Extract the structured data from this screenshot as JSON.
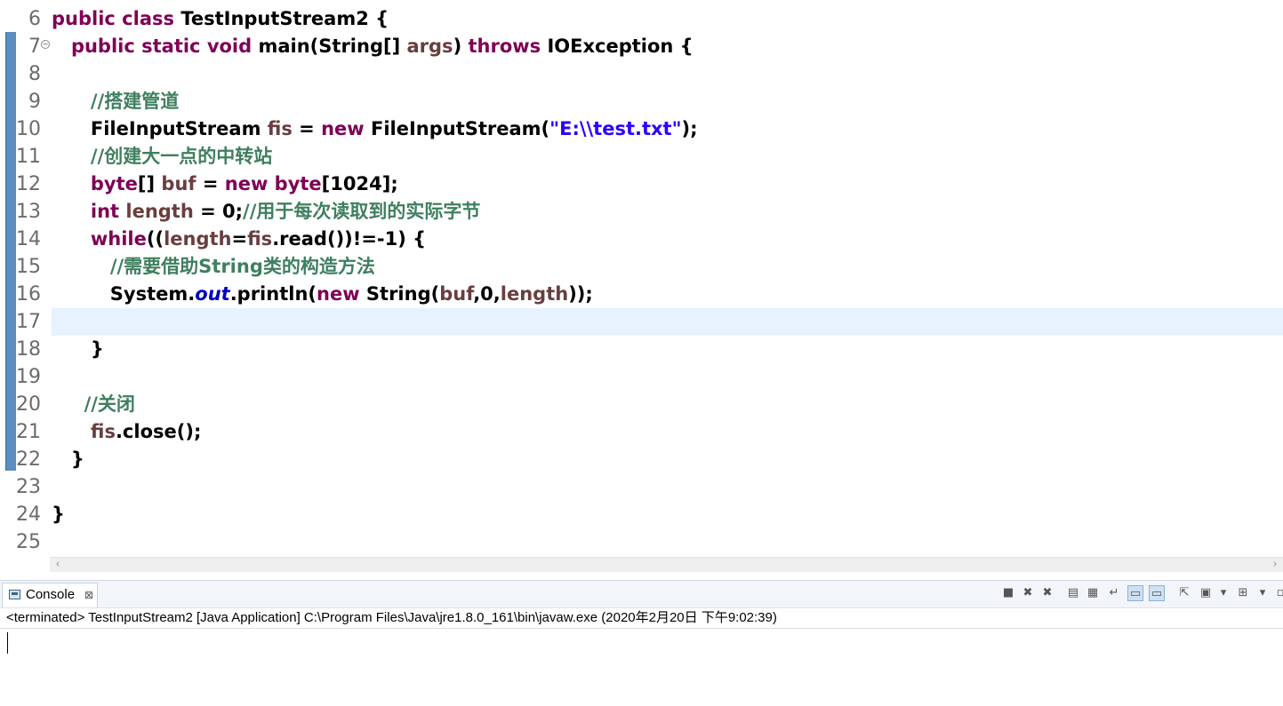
{
  "editor": {
    "lines": [
      {
        "n": "6",
        "segs": [
          {
            "t": "public class ",
            "c": "k"
          },
          {
            "t": "TestInputStream2 {",
            "c": ""
          }
        ]
      },
      {
        "n": "7",
        "fold": true,
        "segs": [
          {
            "t": "   ",
            "c": ""
          },
          {
            "t": "public static void ",
            "c": "k"
          },
          {
            "t": "main(String[] ",
            "c": ""
          },
          {
            "t": "args",
            "c": "v"
          },
          {
            "t": ") ",
            "c": ""
          },
          {
            "t": "throws ",
            "c": "k"
          },
          {
            "t": "IOException {",
            "c": ""
          }
        ]
      },
      {
        "n": "8",
        "segs": []
      },
      {
        "n": "9",
        "segs": [
          {
            "t": "      ",
            "c": ""
          },
          {
            "t": "//搭建管道",
            "c": "c"
          }
        ]
      },
      {
        "n": "10",
        "segs": [
          {
            "t": "      FileInputStream ",
            "c": ""
          },
          {
            "t": "fis",
            "c": "v"
          },
          {
            "t": " = ",
            "c": ""
          },
          {
            "t": "new ",
            "c": "k"
          },
          {
            "t": "FileInputStream(",
            "c": ""
          },
          {
            "t": "\"E:\\\\test.txt\"",
            "c": "s"
          },
          {
            "t": ");",
            "c": ""
          }
        ]
      },
      {
        "n": "11",
        "segs": [
          {
            "t": "      ",
            "c": ""
          },
          {
            "t": "//创建大一点的中转站",
            "c": "c"
          }
        ]
      },
      {
        "n": "12",
        "segs": [
          {
            "t": "      ",
            "c": ""
          },
          {
            "t": "byte",
            "c": "k"
          },
          {
            "t": "[] ",
            "c": ""
          },
          {
            "t": "buf",
            "c": "v"
          },
          {
            "t": " = ",
            "c": ""
          },
          {
            "t": "new ",
            "c": "k"
          },
          {
            "t": "byte",
            "c": "k"
          },
          {
            "t": "[1024];",
            "c": ""
          }
        ]
      },
      {
        "n": "13",
        "segs": [
          {
            "t": "      ",
            "c": ""
          },
          {
            "t": "int ",
            "c": "k"
          },
          {
            "t": "length",
            "c": "v"
          },
          {
            "t": " = 0;",
            "c": ""
          },
          {
            "t": "//用于每次读取到的实际字节",
            "c": "c"
          }
        ]
      },
      {
        "n": "14",
        "segs": [
          {
            "t": "      ",
            "c": ""
          },
          {
            "t": "while",
            "c": "k"
          },
          {
            "t": "((",
            "c": ""
          },
          {
            "t": "length",
            "c": "v"
          },
          {
            "t": "=",
            "c": ""
          },
          {
            "t": "fis",
            "c": "v"
          },
          {
            "t": ".read())!=-1) {",
            "c": ""
          }
        ]
      },
      {
        "n": "15",
        "segs": [
          {
            "t": "         ",
            "c": ""
          },
          {
            "t": "//需要借助String类的构造方法",
            "c": "c"
          }
        ]
      },
      {
        "n": "16",
        "segs": [
          {
            "t": "         System.",
            "c": ""
          },
          {
            "t": "out",
            "c": "f"
          },
          {
            "t": ".println(",
            "c": ""
          },
          {
            "t": "new ",
            "c": "k"
          },
          {
            "t": "String(",
            "c": ""
          },
          {
            "t": "buf",
            "c": "v"
          },
          {
            "t": ",0,",
            "c": ""
          },
          {
            "t": "length",
            "c": "v"
          },
          {
            "t": "));",
            "c": ""
          }
        ]
      },
      {
        "n": "17",
        "current": true,
        "segs": []
      },
      {
        "n": "18",
        "segs": [
          {
            "t": "      }",
            "c": ""
          }
        ]
      },
      {
        "n": "19",
        "segs": []
      },
      {
        "n": "20",
        "segs": [
          {
            "t": "     ",
            "c": ""
          },
          {
            "t": "//关闭",
            "c": "c"
          }
        ]
      },
      {
        "n": "21",
        "segs": [
          {
            "t": "      ",
            "c": ""
          },
          {
            "t": "fis",
            "c": "v"
          },
          {
            "t": ".close();",
            "c": ""
          }
        ]
      },
      {
        "n": "22",
        "segs": [
          {
            "t": "   }",
            "c": ""
          }
        ]
      },
      {
        "n": "23",
        "segs": []
      },
      {
        "n": "24",
        "segs": [
          {
            "t": "}",
            "c": ""
          }
        ]
      },
      {
        "n": "25",
        "segs": []
      }
    ],
    "scroll_left_icon": "chevron-left-icon",
    "scroll_right_icon": "chevron-right-icon"
  },
  "console": {
    "tab_label": "Console",
    "tab_close": "⊠",
    "status": "<terminated> TestInputStream2 [Java Application] C:\\Program Files\\Java\\jre1.8.0_161\\bin\\javaw.exe (2020年2月20日 下午9:02:39)",
    "toolbar_icons": [
      "terminate-icon",
      "remove-launch-icon",
      "remove-all-terminated-icon",
      "clear-console-icon",
      "scroll-lock-icon",
      "word-wrap-icon",
      "show-console-on-stdout-icon",
      "show-console-on-stderr-icon",
      "pin-console-icon",
      "display-selected-console-icon",
      "dropdown-icon",
      "open-console-icon",
      "dropdown-icon",
      "minimize-icon"
    ]
  }
}
